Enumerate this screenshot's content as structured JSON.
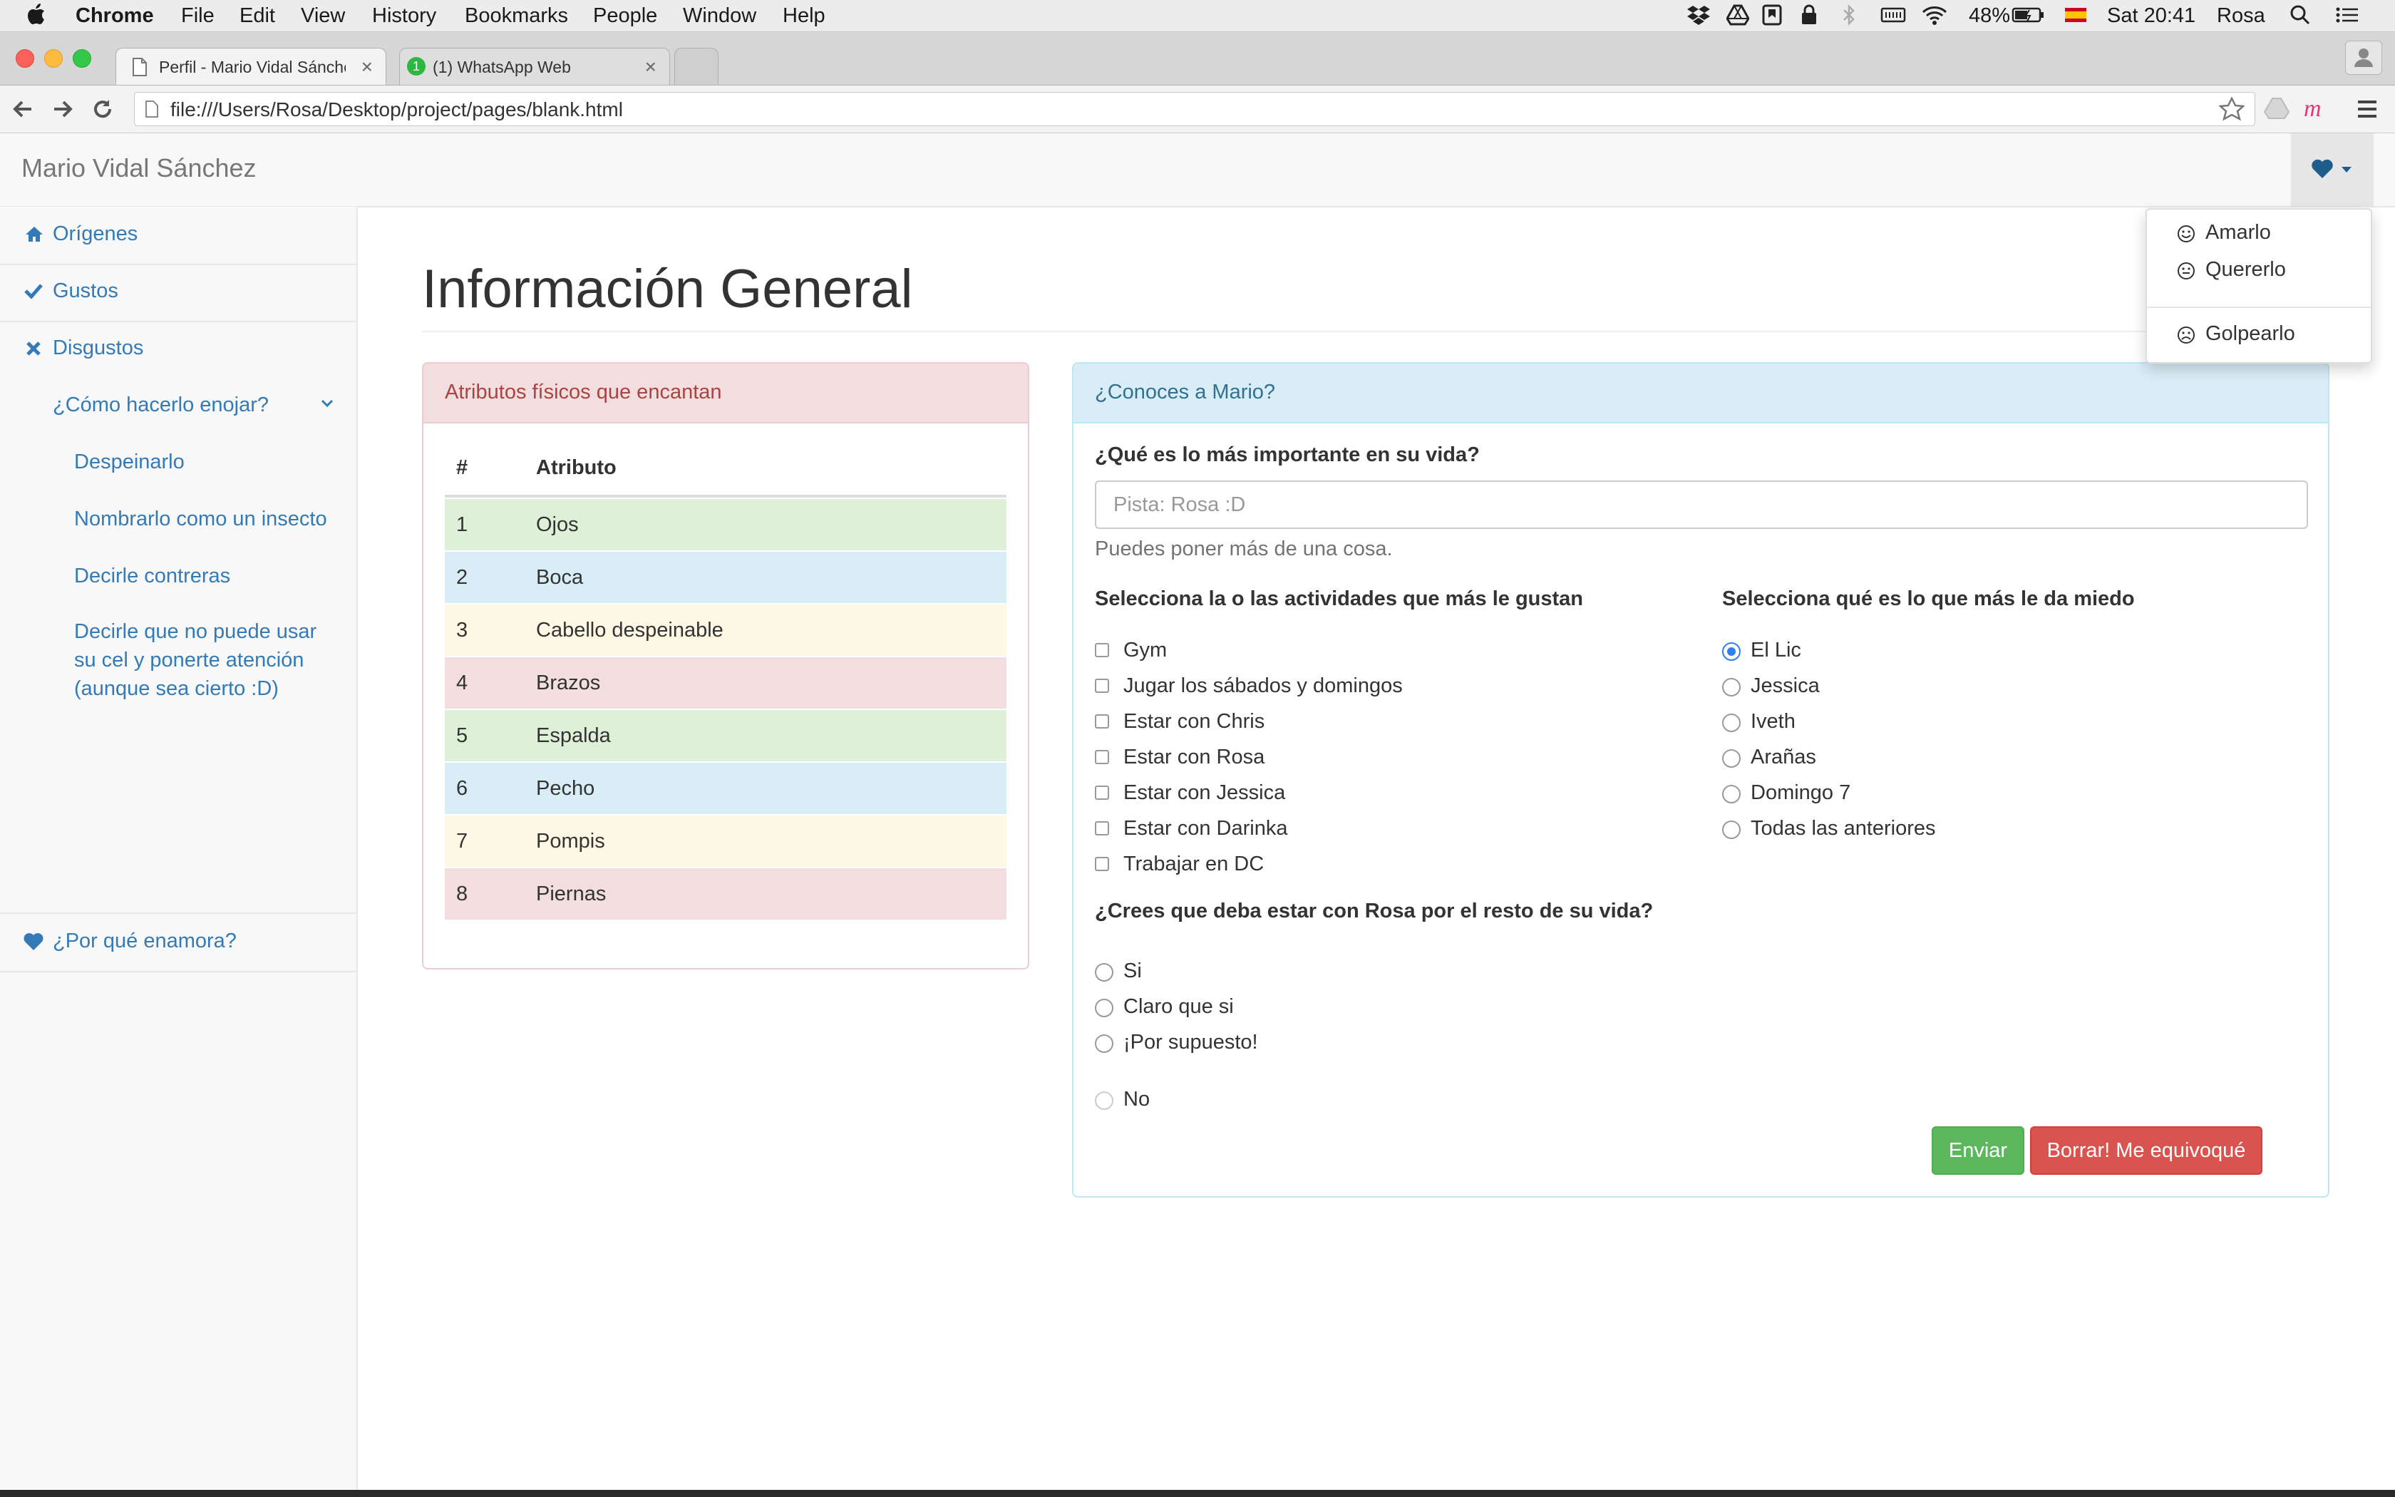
{
  "menubar": {
    "app": "Chrome",
    "items": [
      "File",
      "Edit",
      "View",
      "History",
      "Bookmarks",
      "People",
      "Window",
      "Help"
    ],
    "battery": "48%",
    "clock": "Sat 20:41",
    "user": "Rosa"
  },
  "browser": {
    "tabs": [
      {
        "title": "Perfil - Mario Vidal Sánchez"
      },
      {
        "title": "(1) WhatsApp Web",
        "badge": "1"
      }
    ],
    "url": "file:///Users/Rosa/Desktop/project/pages/blank.html"
  },
  "navbar": {
    "brand": "Mario Vidal Sánchez",
    "dropdown": [
      {
        "label": "Amarlo",
        "icon": "smile-icon"
      },
      {
        "label": "Quererlo",
        "icon": "neutral-face-icon"
      },
      {
        "label": "Golpearlo",
        "icon": "frown-icon"
      }
    ]
  },
  "sidebar": {
    "items": [
      {
        "label": "Orígenes",
        "icon": "home-icon"
      },
      {
        "label": "Gustos",
        "icon": "check-icon"
      },
      {
        "label": "Disgustos",
        "icon": "x-icon"
      }
    ],
    "submenu": {
      "label": "¿Cómo hacerlo enojar?",
      "children": [
        "Despeinarlo",
        "Nombrarlo como un insecto",
        "Decirle contreras"
      ],
      "long_child_lines": [
        "Decirle que no puede usar",
        "su cel y ponerte atención",
        "(aunque sea cierto :D)"
      ]
    },
    "last_item": {
      "label": "¿Por qué enamora?",
      "icon": "heart-icon"
    }
  },
  "page": {
    "title": "Información General"
  },
  "attributes_panel": {
    "heading": "Atributos físicos que encantan",
    "columns": [
      "#",
      "Atributo"
    ],
    "rows": [
      {
        "n": "1",
        "attr": "Ojos"
      },
      {
        "n": "2",
        "attr": "Boca"
      },
      {
        "n": "3",
        "attr": "Cabello despeinable"
      },
      {
        "n": "4",
        "attr": "Brazos"
      },
      {
        "n": "5",
        "attr": "Espalda"
      },
      {
        "n": "6",
        "attr": "Pecho"
      },
      {
        "n": "7",
        "attr": "Pompis"
      },
      {
        "n": "8",
        "attr": "Piernas"
      }
    ],
    "row_colors": [
      "#dff0d8",
      "#d9edf7",
      "#fcf8e3",
      "#f2dede"
    ]
  },
  "quiz_panel": {
    "heading": "¿Conoces a Mario?",
    "q1": {
      "label": "¿Qué es lo más importante en su vida?",
      "placeholder": "Pista: Rosa :D",
      "value": "",
      "help": "Puedes poner más de una cosa."
    },
    "q2": {
      "label": "Selecciona la o las actividades que más le gustan",
      "options": [
        "Gym",
        "Jugar los sábados y domingos",
        "Estar con Chris",
        "Estar con Rosa",
        "Estar con Jessica",
        "Estar con Darinka",
        "Trabajar en DC"
      ]
    },
    "q3": {
      "label": "Selecciona qué es lo que más le da miedo",
      "options": [
        "El Lic",
        "Jessica",
        "Iveth",
        "Arañas",
        "Domingo 7",
        "Todas las anteriores"
      ],
      "selected": "El Lic"
    },
    "q4": {
      "label": "¿Crees que deba estar con Rosa por el resto de su vida?",
      "options": [
        "Si",
        "Claro que si",
        "¡Por supuesto!"
      ],
      "disabled_option": "No"
    },
    "submit_label": "Enviar",
    "reset_label": "Borrar! Me equivoqué"
  },
  "colors": {
    "link": "#337ab7",
    "danger": "#d9534f",
    "success": "#5cb85c",
    "info_bg": "#d9edf7",
    "danger_bg": "#f2dede"
  }
}
